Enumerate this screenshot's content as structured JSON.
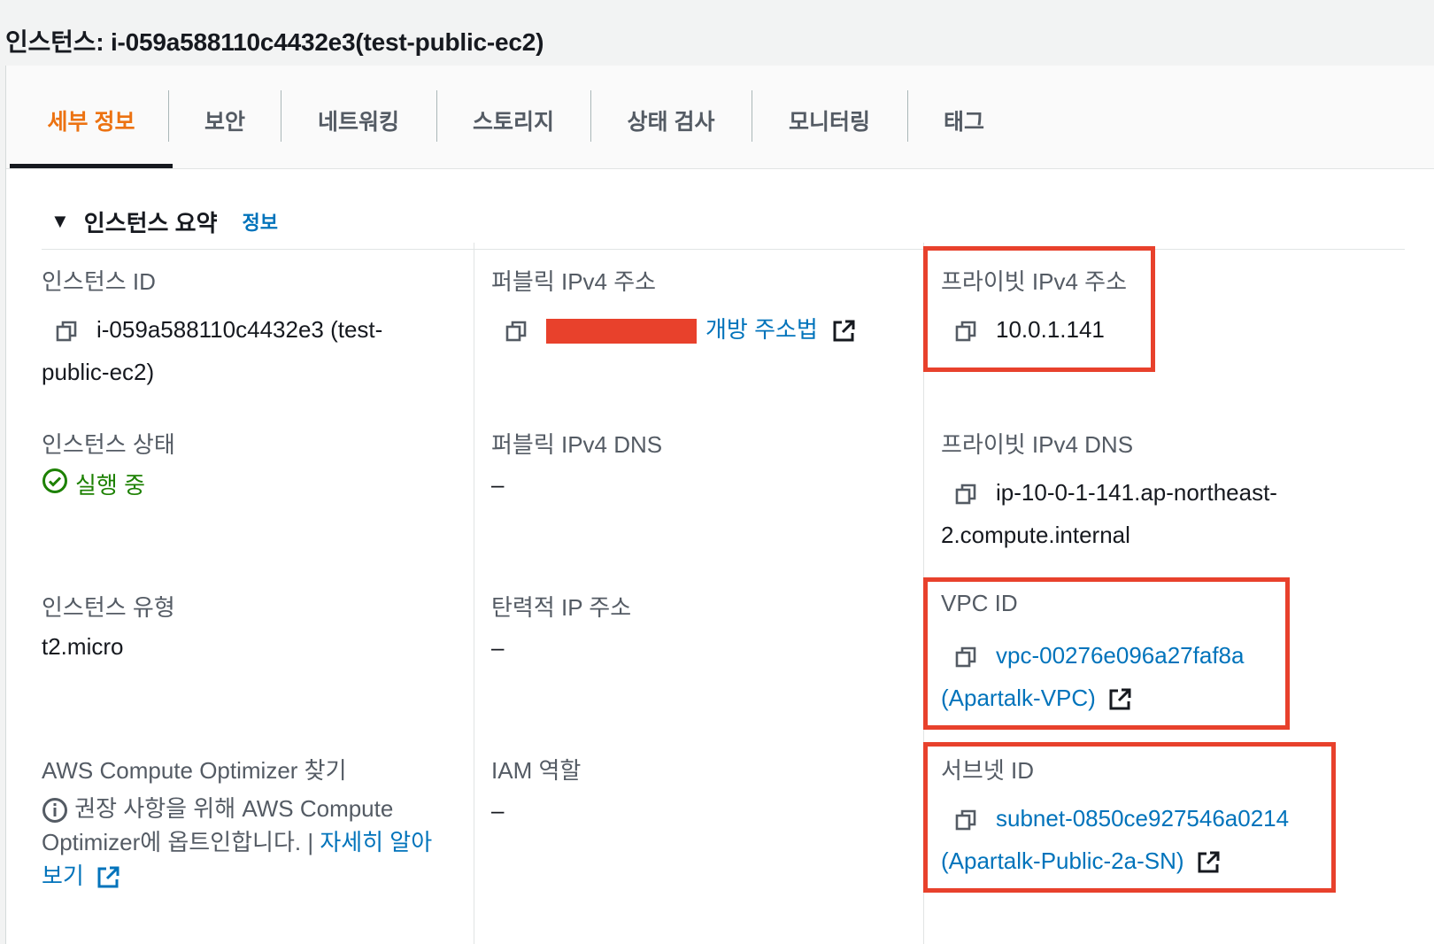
{
  "page": {
    "title": "인스턴스: i-059a588110c4432e3(test-public-ec2)"
  },
  "tabs": [
    {
      "label": "세부 정보",
      "active": true
    },
    {
      "label": "보안"
    },
    {
      "label": "네트워킹"
    },
    {
      "label": "스토리지"
    },
    {
      "label": "상태 검사"
    },
    {
      "label": "모니터링"
    },
    {
      "label": "태그"
    }
  ],
  "section": {
    "title": "인스턴스 요약",
    "info_link": "정보"
  },
  "fields": {
    "instance_id": {
      "label": "인스턴스 ID",
      "value_line1": "i-059a588110c4432e3 (test-",
      "value_line2": "public-ec2)"
    },
    "public_ipv4": {
      "label": "퍼블릭 IPv4 주소",
      "link": "개방 주소법"
    },
    "private_ipv4": {
      "label": "프라이빗 IPv4 주소",
      "value": "10.0.1.141"
    },
    "instance_state": {
      "label": "인스턴스 상태",
      "value": "실행 중"
    },
    "public_dns": {
      "label": "퍼블릭 IPv4 DNS",
      "value": "–"
    },
    "private_dns": {
      "label": "프라이빗 IPv4 DNS",
      "value_line1": "ip-10-0-1-141.ap-northeast-",
      "value_line2": "2.compute.internal"
    },
    "instance_type": {
      "label": "인스턴스 유형",
      "value": "t2.micro"
    },
    "elastic_ip": {
      "label": "탄력적 IP 주소",
      "value": "–"
    },
    "vpc_id": {
      "label": "VPC ID",
      "value_line1": "vpc-00276e096a27faf8a",
      "value_line2": "(Apartalk-VPC)"
    },
    "compute_optimizer": {
      "label": "AWS Compute Optimizer 찾기",
      "text_line1": "권장 사항을 위해 AWS Compute",
      "text_line2": "Optimizer에 옵트인합니다. | ",
      "link_line2": "자세히 알아",
      "link_line3": "보기"
    },
    "iam_role": {
      "label": "IAM 역할",
      "value": "–"
    },
    "subnet_id": {
      "label": "서브넷 ID",
      "value_line1": "subnet-0850ce927546a0214",
      "value_line2": "(Apartalk-Public-2a-SN)"
    }
  },
  "colors": {
    "accent": "#ec7211",
    "link": "#0073bb",
    "success": "#1d8102",
    "highlight": "#e8412c"
  },
  "icons": {
    "copy": "copy-icon",
    "external": "external-link-icon",
    "caret": "caret-down-icon",
    "status": "check-circle-icon",
    "info": "info-circle-icon"
  }
}
